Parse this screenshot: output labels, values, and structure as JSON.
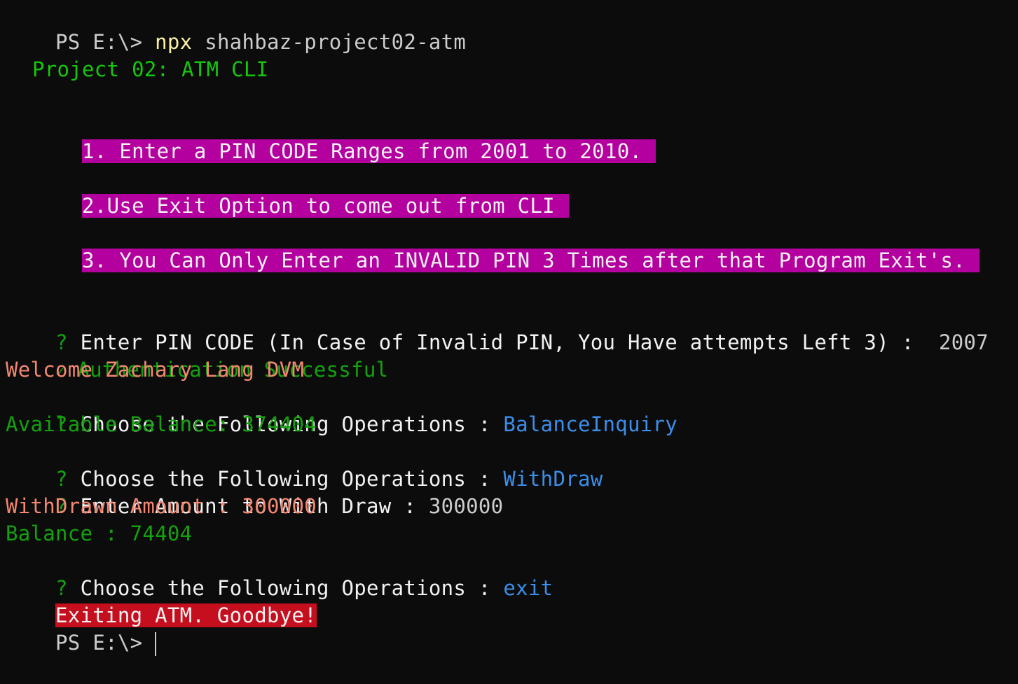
{
  "prompt": {
    "ps": "PS E:\\>",
    "cmd": "npx",
    "args": "shahbaz-project02-atm"
  },
  "header": {
    "title": "Project 02: ATM CLI",
    "rule1": "1. Enter a PIN CODE Ranges from 2001 to 2010.",
    "rule2": "2.Use Exit Option to come out from CLI",
    "rule3": "3. You Can Only Enter an INVALID PIN 3 Times after that Program Exit's."
  },
  "session": {
    "q_mark": "?",
    "check_mark": "✓",
    "pin_prompt": "Enter PIN CODE (In Case of Invalid PIN, You Have attempts Left 3) :",
    "pin_value": "2007",
    "auth": "Authentication Successful",
    "welcome": "Welcome Zachary Lang DVM",
    "op_prompt": "Choose the Following Operations :",
    "op1": "BalanceInquiry",
    "available_balance": "Available Balance: 374404",
    "op2": "WithDraw",
    "amount_prompt": "Enter Amount to With Draw :",
    "amount_value": "300000",
    "withdrawn": "WithDrawn Amount : 300000",
    "balance": "Balance : 74404",
    "op3": "exit",
    "goodbye": "Exiting ATM. Goodbye!"
  },
  "final_prompt": "PS E:\\>",
  "colors": {
    "background": "#0c0c0c",
    "green": "#13a10e",
    "magenta_highlight": "#b4009e",
    "red_highlight": "#c50f1f",
    "salmon": "#f48771",
    "blue": "#3b8eea",
    "yellow": "#f9f1a5"
  }
}
